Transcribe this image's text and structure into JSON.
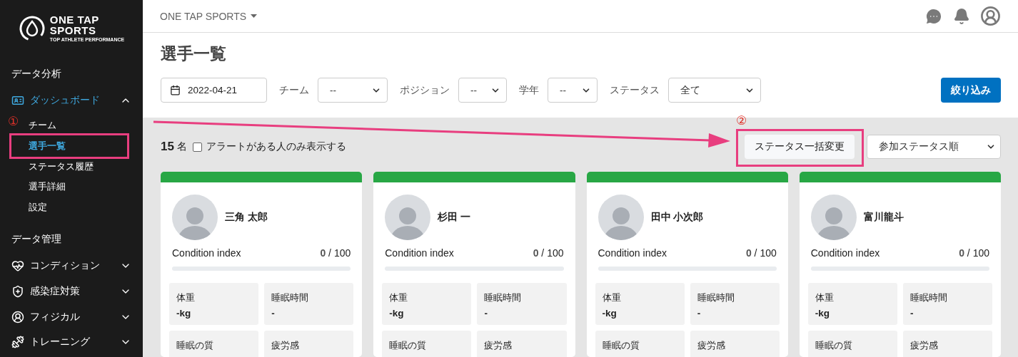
{
  "logo": {
    "line_1": "ONE TAP",
    "line_2": "SPORTS",
    "tagline": "TOP ATHLETE PERFORMANCE"
  },
  "sidebar": {
    "sections": [
      {
        "title": "データ分析",
        "items": [
          {
            "label": "ダッシュボード",
            "expanded": true,
            "children": [
              {
                "label": "チーム",
                "selected": false
              },
              {
                "label": "選手一覧",
                "selected": true
              },
              {
                "label": "ステータス履歴",
                "selected": false
              },
              {
                "label": "選手詳細",
                "selected": false
              },
              {
                "label": "設定",
                "selected": false
              }
            ]
          }
        ]
      },
      {
        "title": "データ管理",
        "items": [
          {
            "label": "コンディション",
            "expanded": false
          },
          {
            "label": "感染症対策",
            "expanded": false
          },
          {
            "label": "フィジカル",
            "expanded": false
          },
          {
            "label": "トレーニング",
            "expanded": false
          }
        ]
      }
    ]
  },
  "header": {
    "team_switcher": "ONE TAP SPORTS"
  },
  "page_title": "選手一覧",
  "filters": {
    "date": "2022-04-21",
    "selects": [
      {
        "label": "チーム",
        "value": "--"
      },
      {
        "label": "ポジション",
        "value": "--"
      },
      {
        "label": "学年",
        "value": "--"
      },
      {
        "label": "ステータス",
        "value": "全て"
      }
    ],
    "apply_button": "絞り込み"
  },
  "toolbar": {
    "count": "15",
    "count_unit": "名",
    "alert_only": {
      "label": "アラートがある人のみ表示する",
      "checked": false
    },
    "bulk_button": "ステータス一括変更",
    "sort": "参加ステータス順"
  },
  "annotations": {
    "sidebar_marker": "①",
    "toolbar_marker": "②"
  },
  "players": [
    {
      "name": "三角 太郎",
      "color": "#28a745",
      "condition_label": "Condition index",
      "condition_score": "**0** / 100",
      "level": 0,
      "metrics": [
        {
          "label": "体重",
          "value": "-kg"
        },
        {
          "label": "睡眠時間",
          "value": "-"
        },
        {
          "label": "睡眠の質"
        },
        {
          "label": "疲労感"
        }
      ]
    },
    {
      "name": "杉田 一",
      "color": "#28a745",
      "condition_label": "Condition index",
      "condition_score": "**0** / 100",
      "level": 0,
      "metrics": [
        {
          "label": "体重",
          "value": "-kg"
        },
        {
          "label": "睡眠時間",
          "value": "-"
        },
        {
          "label": "睡眠の質"
        },
        {
          "label": "疲労感"
        }
      ]
    },
    {
      "name": "田中 小次郎",
      "color": "#28a745",
      "condition_label": "Condition index",
      "condition_score": "**0** / 100",
      "level": 0,
      "metrics": [
        {
          "label": "体重",
          "value": "-kg"
        },
        {
          "label": "睡眠時間",
          "value": "-"
        },
        {
          "label": "睡眠の質"
        },
        {
          "label": "疲労感"
        }
      ]
    },
    {
      "name": "富川龍斗",
      "color": "#28a745",
      "condition_label": "Condition index",
      "condition_score": "**0** / 100",
      "level": 0,
      "metrics": [
        {
          "label": "体重",
          "value": "-kg"
        },
        {
          "label": "睡眠時間",
          "value": "-"
        },
        {
          "label": "睡眠の質"
        },
        {
          "label": "疲労感"
        }
      ]
    }
  ]
}
